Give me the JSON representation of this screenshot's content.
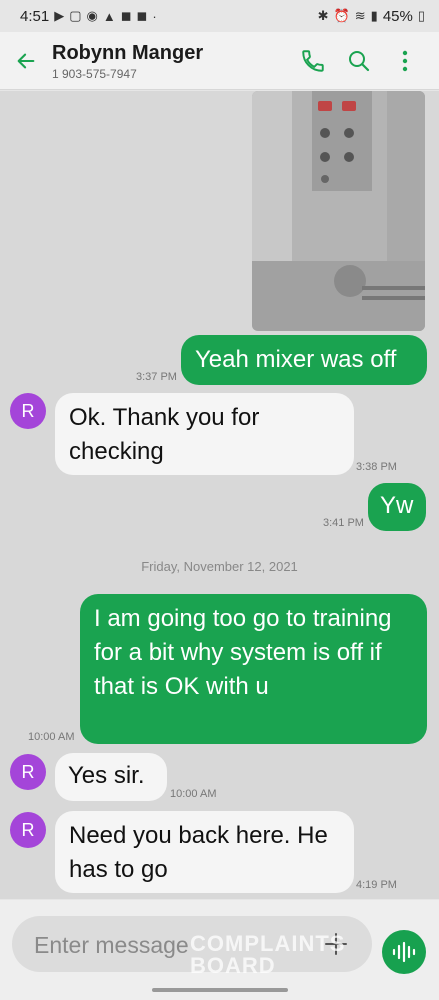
{
  "status": {
    "time": "4:51",
    "battery": "45%"
  },
  "header": {
    "name": "Robynn Manger",
    "phone": "1 903-575-7947"
  },
  "messages": [
    {
      "dir": "out",
      "text": "Yeah mixer was off",
      "time": "3:37 PM"
    },
    {
      "dir": "in",
      "avatar": "R",
      "text": "Ok. Thank you for checking",
      "time": "3:38 PM"
    },
    {
      "dir": "out",
      "text": "Yw",
      "time": "3:41 PM"
    },
    {
      "date": "Friday, November 12, 2021"
    },
    {
      "dir": "out",
      "text": "I am going too go to training for a bit why system is off if that is OK with u",
      "time": "10:00 AM"
    },
    {
      "dir": "in",
      "avatar": "R",
      "text": "Yes sir.",
      "time": "10:00 AM"
    },
    {
      "dir": "in",
      "avatar": "R",
      "text": "Need you back here. He has to go",
      "time": "4:19 PM"
    }
  ],
  "composer": {
    "placeholder": "Enter message"
  },
  "watermark": {
    "line1": "COMPLAINTS",
    "line2": "BOARD"
  },
  "colors": {
    "accent": "#1aa350",
    "avatar": "#a445d9"
  }
}
